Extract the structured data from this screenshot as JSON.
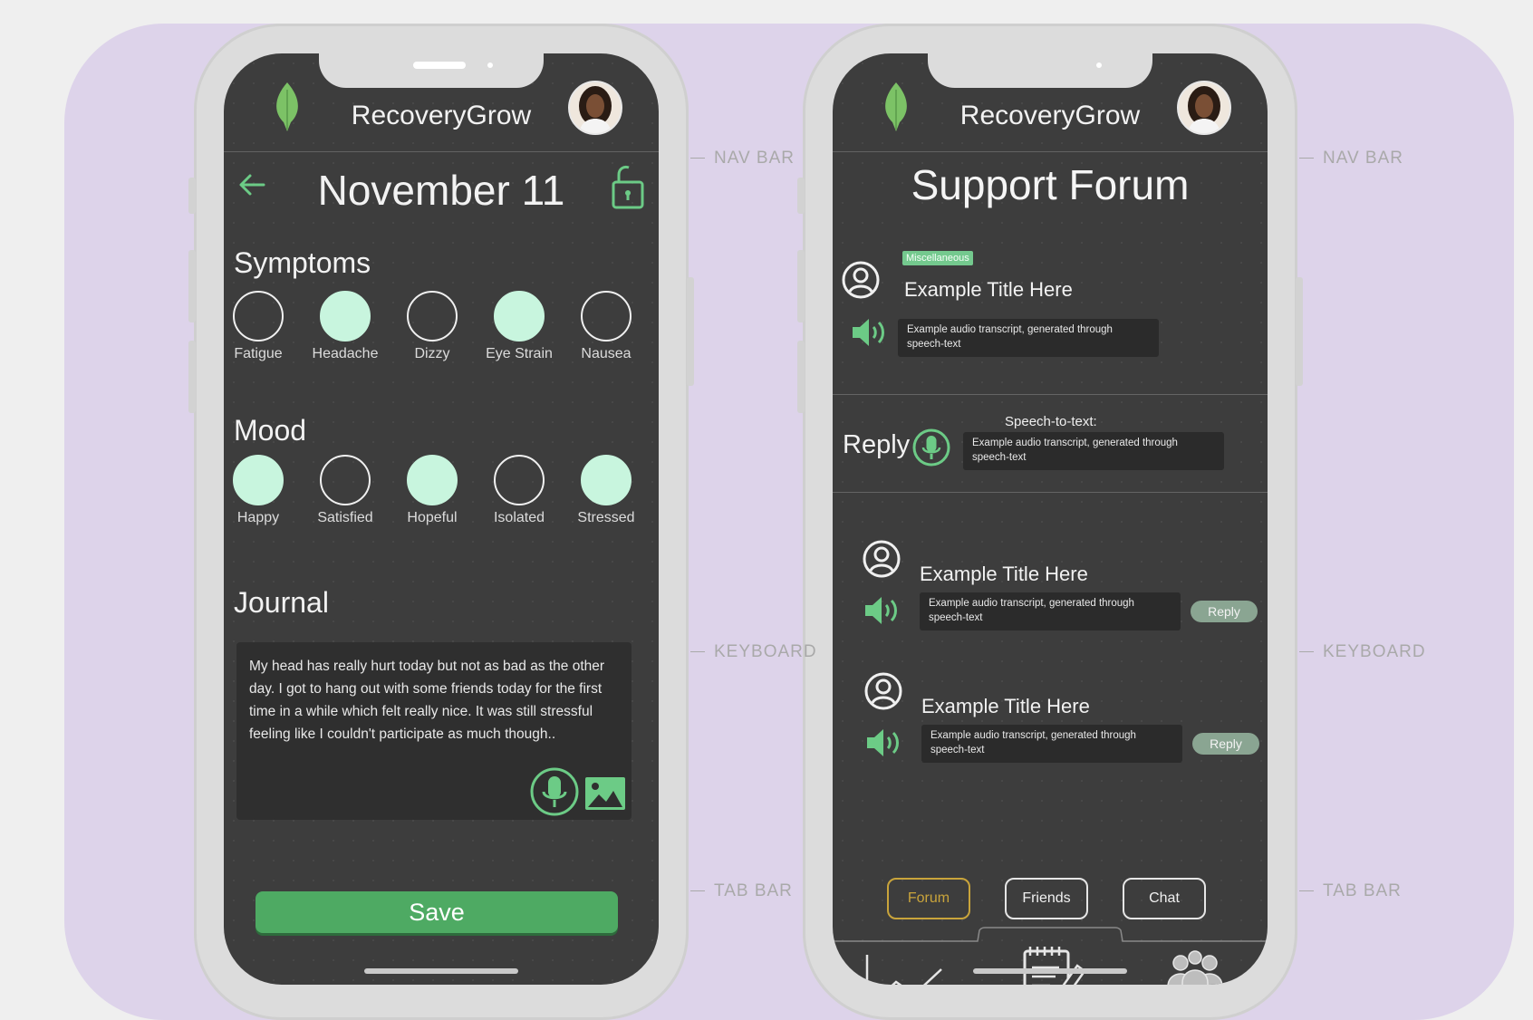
{
  "annotations": {
    "nav_bar": "NAV  BAR",
    "keyboard": "KEYBOARD",
    "tab_bar": "TAB  BAR"
  },
  "colors": {
    "accent_green": "#4eaa63",
    "mint": "#c8f5de",
    "screen_bg": "#3d3d3d",
    "board": "#ddd3ea",
    "active_tab": "#c9a43b"
  },
  "left_phone": {
    "app_title": "RecoveryGrow",
    "date": "November 11",
    "icons": [
      "leaf-icon",
      "back-arrow-icon",
      "unlock-icon",
      "mic-icon",
      "image-icon"
    ],
    "symptoms": {
      "title": "Symptoms",
      "items": [
        {
          "label": "Fatigue",
          "selected": false
        },
        {
          "label": "Headache",
          "selected": true
        },
        {
          "label": "Dizzy",
          "selected": false
        },
        {
          "label": "Eye Strain",
          "selected": true
        },
        {
          "label": "Nausea",
          "selected": false
        }
      ]
    },
    "mood": {
      "title": "Mood",
      "items": [
        {
          "label": "Happy",
          "selected": true
        },
        {
          "label": "Satisfied",
          "selected": false
        },
        {
          "label": "Hopeful",
          "selected": true
        },
        {
          "label": "Isolated",
          "selected": false
        },
        {
          "label": "Stressed",
          "selected": true
        }
      ]
    },
    "journal": {
      "title": "Journal",
      "text": "My head has really hurt today but not as bad as the other day. I got to hang out with some friends today for the first time in a while which felt really nice. It was still stressful feeling like I couldn't participate as much though.."
    },
    "save_label": "Save"
  },
  "right_phone": {
    "app_title": "RecoveryGrow",
    "forum_title": "Support Forum",
    "main_post": {
      "tag": "Miscellaneous",
      "title": "Example Title Here",
      "transcript": "Example audio transcript, generated through speech-text"
    },
    "reply_box": {
      "label": "Reply",
      "stt_label": "Speech-to-text:",
      "transcript": "Example audio transcript, generated through speech-text"
    },
    "replies": [
      {
        "title": "Example Title Here",
        "transcript": "Example audio transcript, generated through speech-text",
        "reply_label": "Reply"
      },
      {
        "title": "Example Title Here",
        "transcript": "Example audio transcript, generated through speech-text",
        "reply_label": "Reply"
      }
    ],
    "tabs": [
      {
        "label": "Forum",
        "active": true
      },
      {
        "label": "Friends",
        "active": false
      },
      {
        "label": "Chat",
        "active": false
      }
    ],
    "tabbar_icons": [
      "line-chart-icon",
      "journal-notepad-icon",
      "group-people-icon"
    ]
  }
}
